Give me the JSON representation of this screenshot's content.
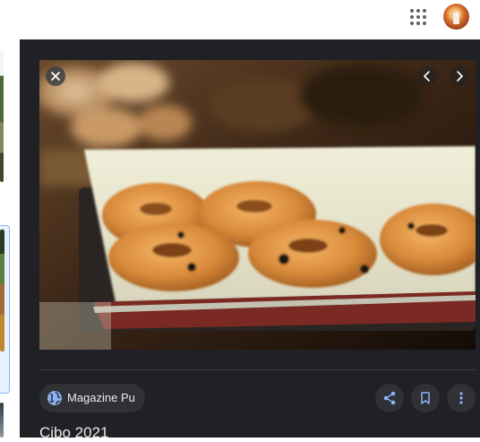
{
  "header": {
    "apps_icon": "apps-grid-icon",
    "avatar_icon": "account-avatar"
  },
  "viewer": {
    "close_icon": "close-icon",
    "prev_icon": "chevron-left-icon",
    "next_icon": "chevron-right-icon",
    "source": {
      "icon": "globe-icon",
      "label": "Magazine Pu"
    },
    "actions": {
      "share_icon": "share-icon",
      "save_icon": "bookmark-icon",
      "more_icon": "more-vert-icon"
    },
    "title": "Cibo 2021"
  },
  "colors": {
    "panel_bg": "#202124",
    "chip_bg": "#303134",
    "text": "#e8eaed",
    "icon_blue": "#8ab4f8",
    "selection": "#8ab4f8"
  }
}
